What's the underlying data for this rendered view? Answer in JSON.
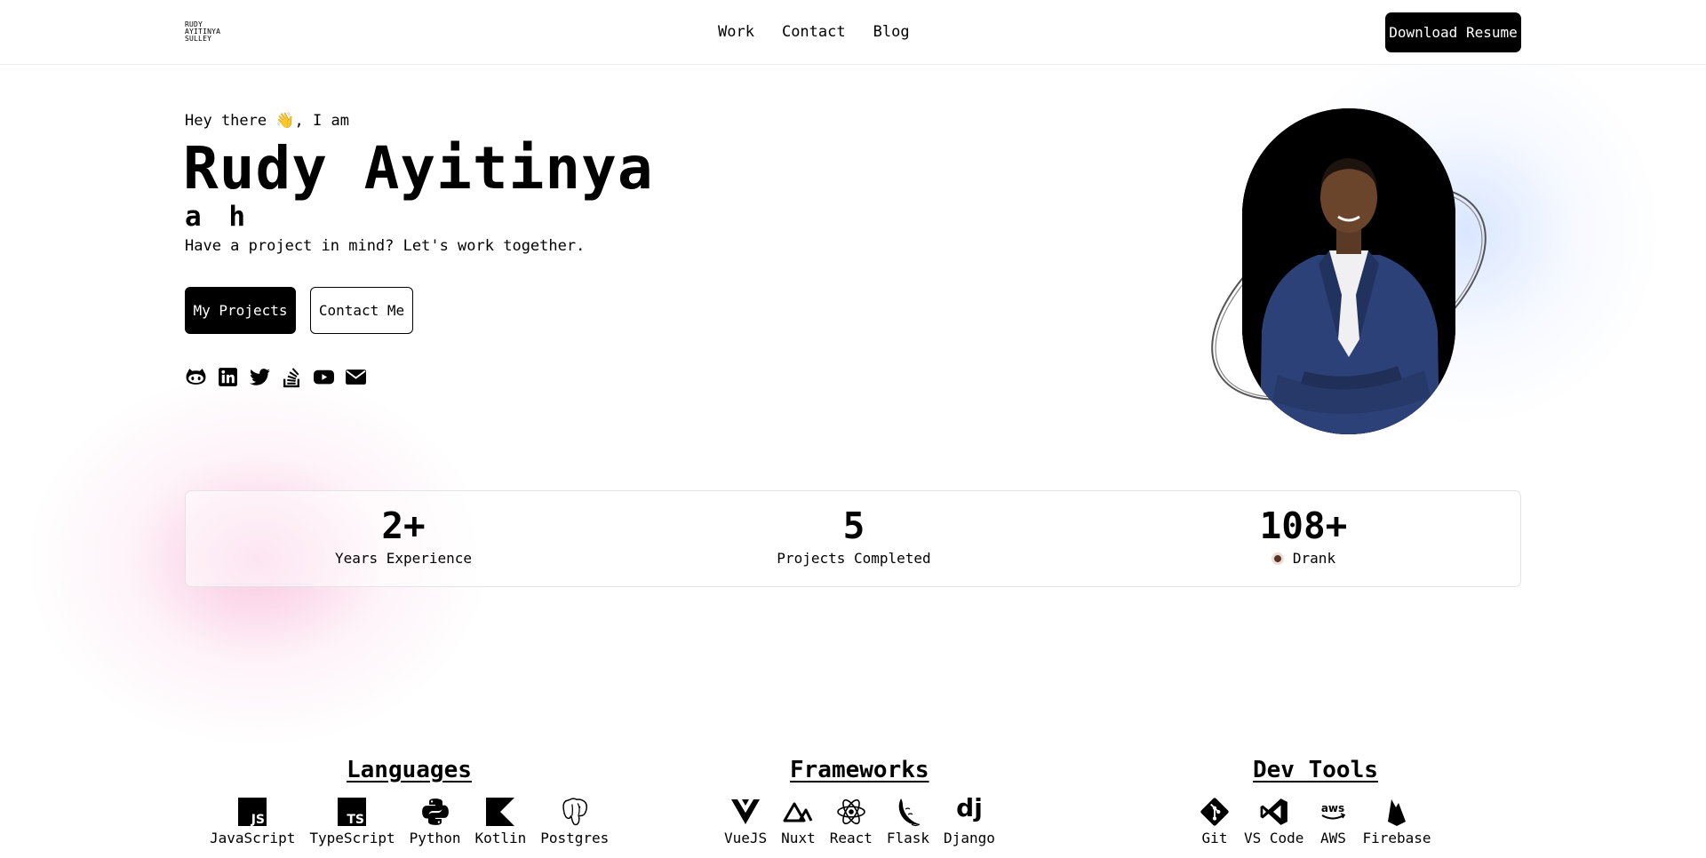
{
  "header": {
    "logo_lines": [
      "RUDY",
      "AYITINYA",
      "SULLEY"
    ],
    "nav": [
      "Work",
      "Contact",
      "Blog"
    ],
    "resume_button": "Download Resume"
  },
  "hero": {
    "greeting": "Hey there 👋, I am",
    "name": "Rudy Ayitinya",
    "typed_text": "a h",
    "subtitle": "Have a project in mind? Let's work together.",
    "primary_button": "My Projects",
    "secondary_button": "Contact Me",
    "socials": [
      "github-icon",
      "linkedin-icon",
      "twitter-icon",
      "stackoverflow-icon",
      "youtube-icon",
      "email-icon"
    ]
  },
  "stats": [
    {
      "value": "2+",
      "label": "Years Experience"
    },
    {
      "value": "5",
      "label": "Projects Completed"
    },
    {
      "value": "108+",
      "label": "Drank",
      "icon": "coffee-icon"
    }
  ],
  "skills": {
    "languages": {
      "title": "Languages",
      "items": [
        {
          "name": "JavaScript",
          "icon": "javascript-icon"
        },
        {
          "name": "TypeScript",
          "icon": "typescript-icon"
        },
        {
          "name": "Python",
          "icon": "python-icon"
        },
        {
          "name": "Kotlin",
          "icon": "kotlin-icon"
        },
        {
          "name": "Postgres",
          "icon": "postgres-icon"
        }
      ]
    },
    "frameworks": {
      "title": "Frameworks",
      "items": [
        {
          "name": "VueJS",
          "icon": "vue-icon"
        },
        {
          "name": "Nuxt",
          "icon": "nuxt-icon"
        },
        {
          "name": "React",
          "icon": "react-icon"
        },
        {
          "name": "Flask",
          "icon": "flask-icon"
        },
        {
          "name": "Django",
          "icon": "django-icon"
        }
      ]
    },
    "devtools": {
      "title": "Dev Tools",
      "items": [
        {
          "name": "Git",
          "icon": "git-icon"
        },
        {
          "name": "VS Code",
          "icon": "vscode-icon"
        },
        {
          "name": "AWS",
          "icon": "aws-icon"
        },
        {
          "name": "Firebase",
          "icon": "firebase-icon"
        }
      ]
    }
  }
}
